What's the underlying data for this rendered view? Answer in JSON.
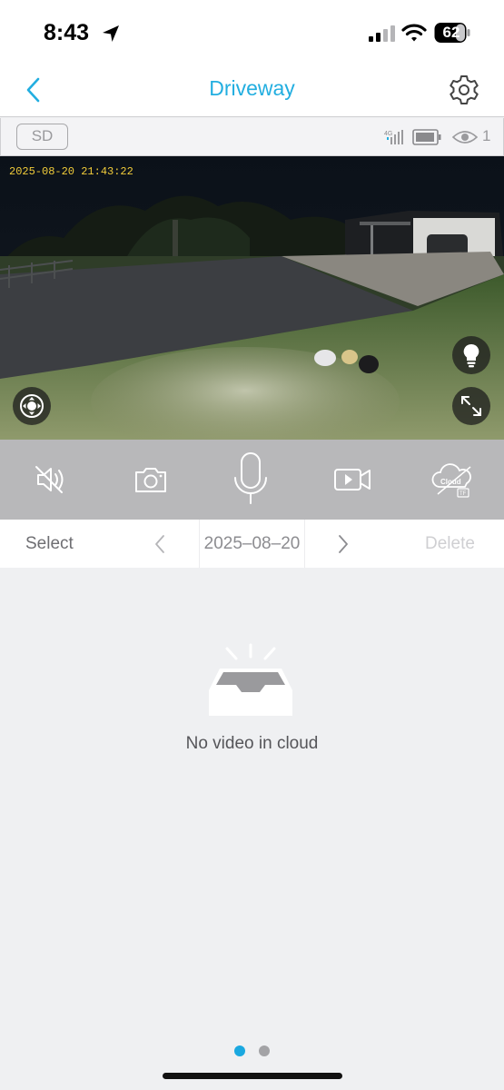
{
  "status_bar": {
    "time": "8:43",
    "battery": "62",
    "icons": [
      "location-arrow-icon",
      "cellular-signal-icon",
      "wifi-icon",
      "battery-icon"
    ]
  },
  "nav": {
    "title": "Driveway",
    "icons": [
      "chevron-left-icon",
      "gear-icon"
    ],
    "accent_color": "#22aee0"
  },
  "camera_bar": {
    "storage_label": "SD",
    "network_label": "4G",
    "viewer_count": "1",
    "icons": [
      "cellular-4g-icon",
      "battery-icon",
      "eye-icon"
    ]
  },
  "video": {
    "timestamp": "2025-08-20 21:43:22",
    "overlay_buttons": [
      "ptz-joystick-icon",
      "lightbulb-icon",
      "fullscreen-icon"
    ]
  },
  "controls": {
    "buttons": [
      "speaker-muted-icon",
      "camera-snapshot-icon",
      "microphone-icon",
      "video-record-icon",
      "cloud-tf-icon"
    ],
    "cloud_label": "Cloud",
    "tf_label": "TF"
  },
  "date_row": {
    "select_label": "Select",
    "date": "2025–08–20",
    "delete_label": "Delete"
  },
  "empty_state": {
    "message": "No video in cloud",
    "icon": "empty-tray-icon"
  },
  "pager": {
    "pages": 2,
    "active_page": 1,
    "active_color": "#1aa8e0"
  }
}
